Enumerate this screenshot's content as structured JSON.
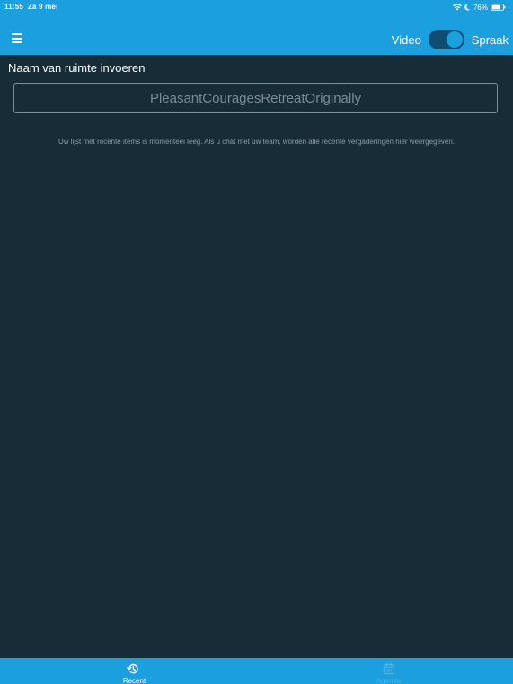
{
  "status_bar": {
    "time": "11:55",
    "date": "Za 9 mei",
    "battery": "76%"
  },
  "nav": {
    "menu_icon": "hamburger-menu-icon",
    "video_label": "Video",
    "spraak_label": "Spraak",
    "mode_toggle_on": true
  },
  "room": {
    "label": "Naam van ruimte invoeren",
    "placeholder": "PleasantCouragesRetreatOriginally"
  },
  "recent": {
    "empty_message": "Uw lijst met recente items is momenteel leeg. Als u chat met uw team, worden alle recente vergaderingen hier weergegeven."
  },
  "tabs": [
    {
      "label": "Recent",
      "icon": "history-icon",
      "active": true
    },
    {
      "label": "Agenda",
      "icon": "calendar-icon",
      "active": false
    }
  ],
  "colors": {
    "brand_blue": "#1b9fdf",
    "background": "#172c37",
    "toggle_track": "#0e4c72",
    "inactive_tab": "#4fb3e6"
  }
}
